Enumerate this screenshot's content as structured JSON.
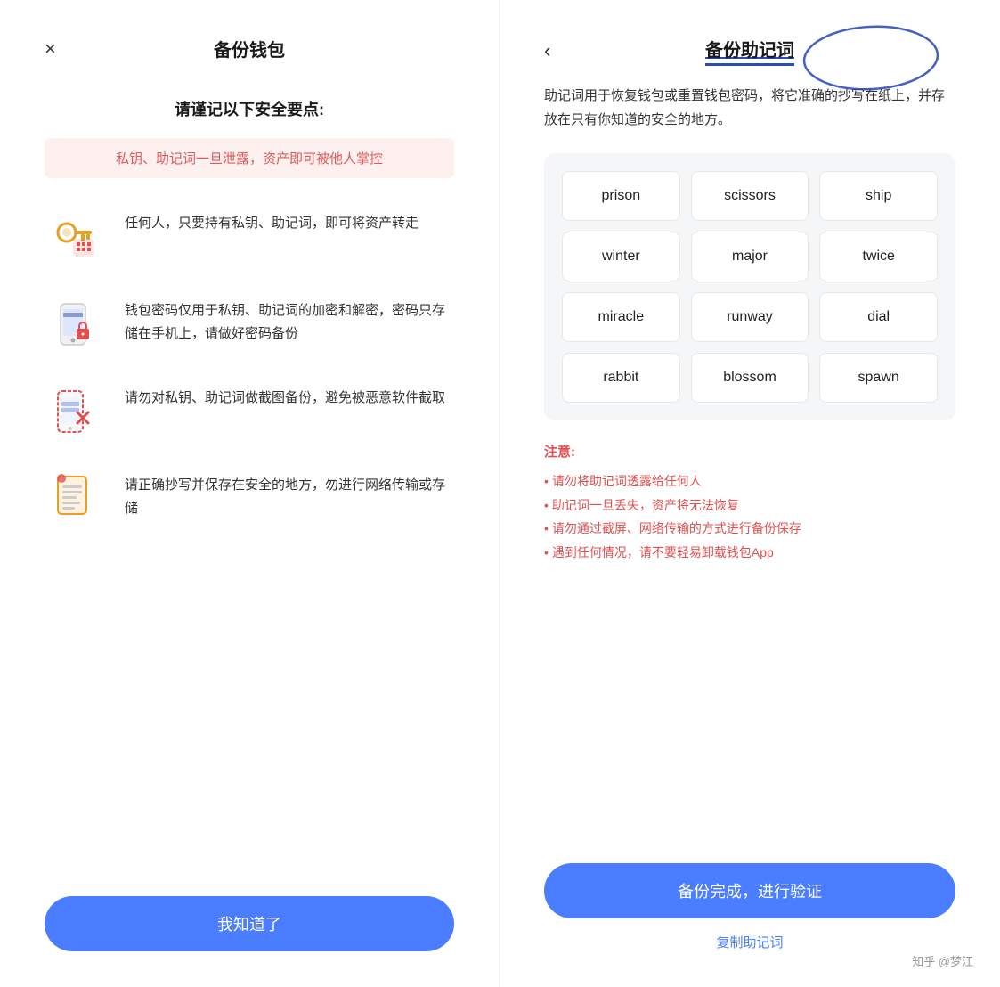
{
  "left": {
    "close_icon": "×",
    "title": "备份钱包",
    "subtitle": "请谨记以下安全要点:",
    "warning": "私钥、助记词一旦泄露，资产即可被他人掌控",
    "items": [
      {
        "id": "item-transfer",
        "icon_name": "key-card-icon",
        "text": "任何人，只要持有私钥、助记词，即可将资产转走"
      },
      {
        "id": "item-password",
        "icon_name": "phone-lock-icon",
        "text": "钱包密码仅用于私钥、助记词的加密和解密，密码只存储在手机上，请做好密码备份"
      },
      {
        "id": "item-screenshot",
        "icon_name": "phone-screenshot-icon",
        "text": "请勿对私钥、助记词做截图备份，避免被恶意软件截取"
      },
      {
        "id": "item-copy",
        "icon_name": "document-icon",
        "text": "请正确抄写并保存在安全的地方，勿进行网络传输或存储"
      }
    ],
    "ok_button": "我知道了"
  },
  "right": {
    "back_icon": "‹",
    "title": "备份助记词",
    "description": "助记词用于恢复钱包或重置钱包密码，将它准确的抄写在纸上，并存放在只有你知道的安全的地方。",
    "mnemonic_words": [
      "prison",
      "scissors",
      "ship",
      "winter",
      "major",
      "twice",
      "miracle",
      "runway",
      "dial",
      "rabbit",
      "blossom",
      "spawn"
    ],
    "notes_title": "注意:",
    "notes": [
      "请勿将助记词透露给任何人",
      "助记词一旦丢失，资产将无法恢复",
      "请勿通过截屏、网络传输的方式进行备份保存",
      "遇到任何情况，请不要轻易卸载钱包App"
    ],
    "verify_button": "备份完成，进行验证",
    "copy_button": "复制助记词",
    "watermark": "知乎 @梦江"
  }
}
